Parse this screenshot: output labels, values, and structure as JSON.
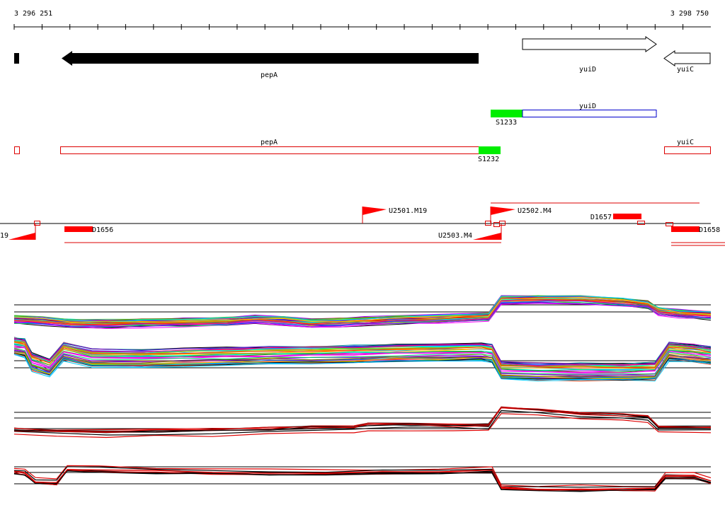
{
  "coordinates": {
    "start": "3 296 251",
    "end": "3 298 750"
  },
  "genes": [
    {
      "id": "pepA",
      "label": "pepA",
      "strand": "reverse",
      "style": "filled"
    },
    {
      "id": "yuiD",
      "label": "yuiD",
      "strand": "forward",
      "style": "outline"
    },
    {
      "id": "yuiC",
      "label": "yuiC",
      "strand": "reverse",
      "style": "outline"
    }
  ],
  "transcripts": [
    {
      "label": "yuiD",
      "color": "#0000cc"
    },
    {
      "label": "pepA",
      "color": "#dd0000"
    },
    {
      "label": "yuiC",
      "color": "#dd0000"
    }
  ],
  "promoters": [
    {
      "label": "S1233",
      "color": "#00ee00"
    },
    {
      "label": "S1232",
      "color": "#00ee00"
    }
  ],
  "upshifts": [
    {
      "label": "U2501.M19"
    },
    {
      "label": "U2502.M4"
    },
    {
      "label": "U2503.M4"
    },
    {
      "label": "19"
    }
  ],
  "downshifts": [
    {
      "label": "D1656"
    },
    {
      "label": "D1657"
    },
    {
      "label": "D1658"
    }
  ],
  "colors": {
    "feature_red": "#ff0000",
    "line_red": "#dd0000",
    "promoter_green": "#00ee00",
    "transcript_blue": "#0000cc"
  }
}
